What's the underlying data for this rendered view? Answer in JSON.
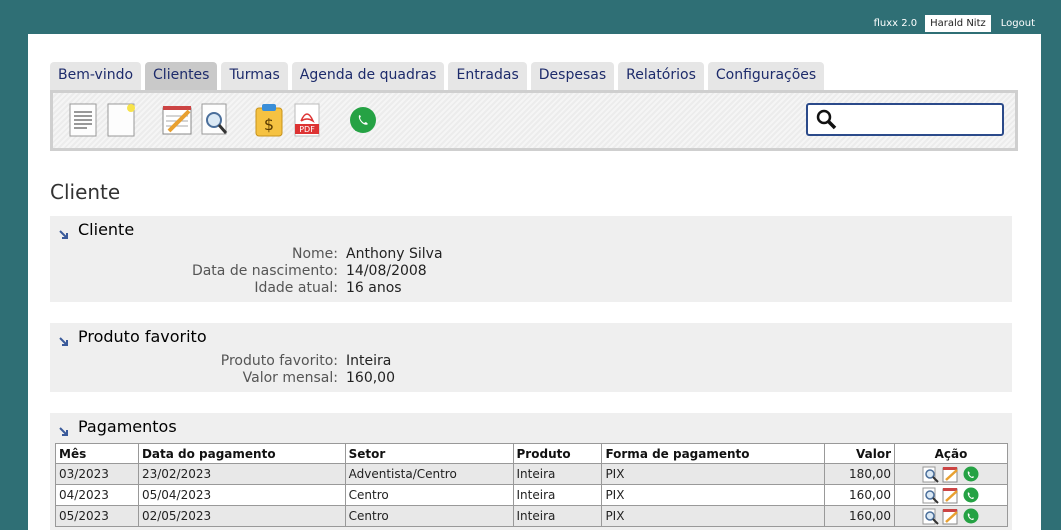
{
  "topbar": {
    "app_version": "fluxx 2.0",
    "user": "Harald Nitz",
    "logout": "Logout"
  },
  "tabs": [
    "Bem-vindo",
    "Clientes",
    "Turmas",
    "Agenda de quadras",
    "Entradas",
    "Despesas",
    "Relatórios",
    "Configurações"
  ],
  "active_tab": "Clientes",
  "toolbar": {
    "icons": [
      "list-document-icon",
      "new-document-icon",
      "edit-notepad-icon",
      "search-document-icon",
      "payment-clipboard-icon",
      "pdf-icon",
      "whatsapp-icon"
    ]
  },
  "search": {
    "value": "",
    "placeholder": ""
  },
  "page_title": "Cliente",
  "cliente": {
    "title": "Cliente",
    "nome_label": "Nome:",
    "nome": "Anthony Silva",
    "nasc_label": "Data de nascimento:",
    "nasc": "14/08/2008",
    "idade_label": "Idade atual:",
    "idade": "16 anos"
  },
  "produto": {
    "title": "Produto favorito",
    "prod_label": "Produto favorito:",
    "prod": "Inteira",
    "valor_label": "Valor mensal:",
    "valor": "160,00"
  },
  "pagamentos": {
    "title": "Pagamentos",
    "headers": {
      "mes": "Mês",
      "data": "Data do pagamento",
      "setor": "Setor",
      "produto": "Produto",
      "forma": "Forma de pagamento",
      "valor": "Valor",
      "acao": "Ação"
    },
    "rows": [
      {
        "mes": "03/2023",
        "data": "23/02/2023",
        "setor": "Adventista/Centro",
        "produto": "Inteira",
        "forma": "PIX",
        "valor": "180,00"
      },
      {
        "mes": "04/2023",
        "data": "05/04/2023",
        "setor": "Centro",
        "produto": "Inteira",
        "forma": "PIX",
        "valor": "160,00"
      },
      {
        "mes": "05/2023",
        "data": "02/05/2023",
        "setor": "Centro",
        "produto": "Inteira",
        "forma": "PIX",
        "valor": "160,00"
      }
    ]
  },
  "colors": {
    "background": "#2f6f75",
    "tab": "#e6e6e6",
    "tab_active": "#c9c9c9",
    "tab_text": "#1d2b6b",
    "whatsapp": "#25a244"
  }
}
